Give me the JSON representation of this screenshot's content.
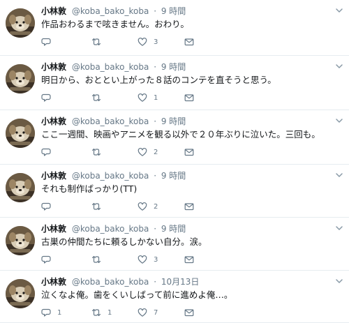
{
  "tweets": [
    {
      "name": "小林敦",
      "handle": "@koba_bako_koba",
      "separator": "·",
      "time": "9 時間",
      "text": "作品おわるまで呟きません。おわり。",
      "replies": "",
      "retweets": "",
      "likes": "3"
    },
    {
      "name": "小林敦",
      "handle": "@koba_bako_koba",
      "separator": "·",
      "time": "9 時間",
      "text": "明日から、おととい上がった８話のコンテを直そうと思う。",
      "replies": "",
      "retweets": "",
      "likes": "1"
    },
    {
      "name": "小林敦",
      "handle": "@koba_bako_koba",
      "separator": "·",
      "time": "9 時間",
      "text": "ここ一週間、映画やアニメを観る以外で２０年ぶりに泣いた。三回も。",
      "replies": "",
      "retweets": "",
      "likes": "2"
    },
    {
      "name": "小林敦",
      "handle": "@koba_bako_koba",
      "separator": "·",
      "time": "9 時間",
      "text": "それも制作ばっかり(TT)",
      "replies": "",
      "retweets": "",
      "likes": "2"
    },
    {
      "name": "小林敦",
      "handle": "@koba_bako_koba",
      "separator": "·",
      "time": "9 時間",
      "text": "古巣の仲間たちに頼るしかない自分。涙。",
      "replies": "",
      "retweets": "",
      "likes": "3"
    },
    {
      "name": "小林敦",
      "handle": "@koba_bako_koba",
      "separator": "·",
      "time": "10月13日",
      "text": "泣くなよ俺。歯をくいしばって前に進めよ俺…。",
      "replies": "1",
      "retweets": "1",
      "likes": "7"
    }
  ],
  "icons": {
    "reply": "reply-icon",
    "retweet": "retweet-icon",
    "like": "heart-icon",
    "dm": "envelope-icon",
    "more": "chevron-down-icon"
  },
  "colors": {
    "text": "#14171a",
    "secondary": "#657786",
    "divider": "#e6ecf0"
  }
}
